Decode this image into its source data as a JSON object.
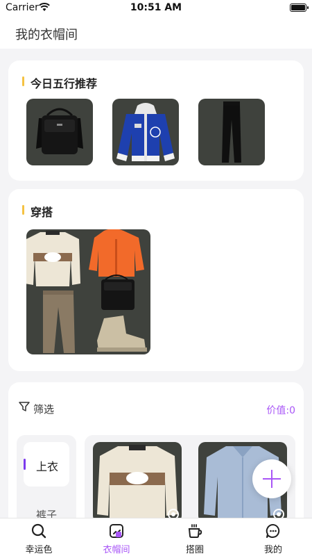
{
  "status_bar": {
    "carrier": "Carrier",
    "time": "10:51 AM"
  },
  "header": {
    "title": "我的衣帽间"
  },
  "recommend": {
    "title": "今日五行推荐",
    "items": [
      {
        "name": "black shoulder bag"
      },
      {
        "name": "blue varsity hoodie jacket"
      },
      {
        "name": "black trousers"
      }
    ]
  },
  "outfit": {
    "title": "穿搭",
    "items": [
      "cream sweatshirt",
      "orange jacket",
      "black shoulder bag",
      "brown trousers",
      "beige boots"
    ]
  },
  "wardrobe": {
    "filter_label": "筛选",
    "value_label": "价值:0",
    "categories": [
      "上衣",
      "裤子"
    ],
    "active_category": "上衣",
    "items": [
      {
        "name": "cream sweatshirt"
      },
      {
        "name": "light blue shirt"
      }
    ]
  },
  "tabs": [
    {
      "label": "幸运色",
      "icon": "search-icon",
      "active": false
    },
    {
      "label": "衣帽间",
      "icon": "wardrobe-icon",
      "active": true
    },
    {
      "label": "搭圈",
      "icon": "coffee-cup-icon",
      "active": false
    },
    {
      "label": "我的",
      "icon": "chat-bubble-icon",
      "active": false
    }
  ],
  "colors": {
    "accent": "#a855f7",
    "title_marker": "#f5c242",
    "category_marker": "#7c3aed",
    "thumb_bg": "#3f423d"
  }
}
